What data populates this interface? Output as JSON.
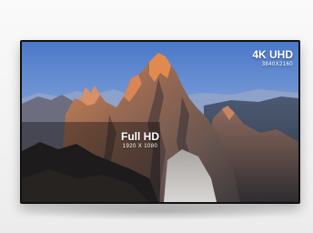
{
  "uhd": {
    "title": "4K UHD",
    "resolution": "3840X2160"
  },
  "fhd": {
    "title": "Full HD",
    "resolution": "1920 X 1080"
  },
  "icons": [
    "mountain-landscape-image"
  ]
}
